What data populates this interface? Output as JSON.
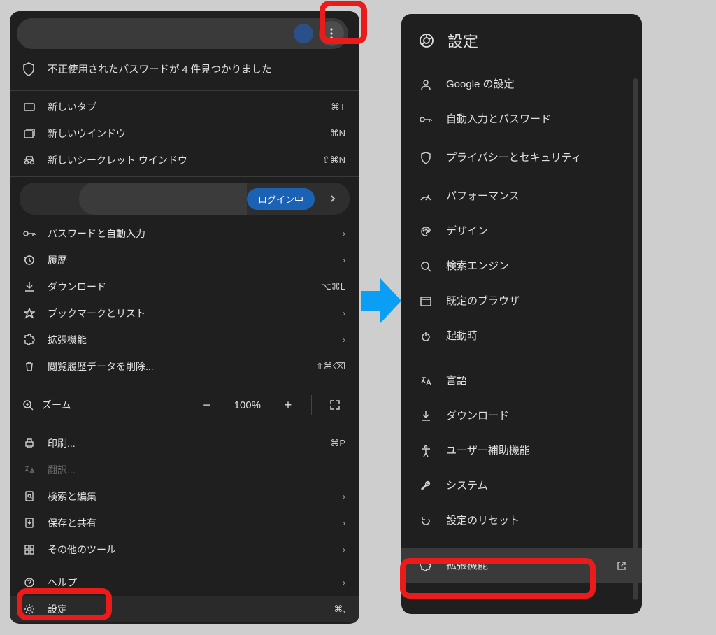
{
  "left": {
    "alert": "不正使用されたパスワードが 4 件見つかりました",
    "new_tab": {
      "label": "新しいタブ",
      "shortcut": "⌘T"
    },
    "new_window": {
      "label": "新しいウインドウ",
      "shortcut": "⌘N"
    },
    "incognito": {
      "label": "新しいシークレット ウインドウ",
      "shortcut": "⇧⌘N"
    },
    "login": "ログイン中",
    "passwords": "パスワードと自動入力",
    "history": "履歴",
    "downloads": {
      "label": "ダウンロード",
      "shortcut": "⌥⌘L"
    },
    "bookmarks": "ブックマークとリスト",
    "extensions": "拡張機能",
    "clear": {
      "label": "閲覧履歴データを削除...",
      "shortcut": "⇧⌘⌫"
    },
    "zoom": {
      "label": "ズーム",
      "value": "100%"
    },
    "print": {
      "label": "印刷...",
      "shortcut": "⌘P"
    },
    "translate": "翻訳...",
    "find": "検索と編集",
    "save": "保存と共有",
    "moretools": "その他のツール",
    "help": "ヘルプ",
    "settings": {
      "label": "設定",
      "shortcut": "⌘,"
    }
  },
  "right": {
    "title": "設定",
    "items": [
      {
        "icon": "person",
        "label": "Google の設定"
      },
      {
        "icon": "key",
        "label": "自動入力とパスワード"
      },
      {
        "icon": "shield",
        "label": "プライバシーとセキュリティ"
      },
      {
        "icon": "speed",
        "label": "パフォーマンス"
      },
      {
        "icon": "palette",
        "label": "デザイン"
      },
      {
        "icon": "search",
        "label": "検索エンジン"
      },
      {
        "icon": "browser",
        "label": "既定のブラウザ"
      },
      {
        "icon": "power",
        "label": "起動時"
      },
      {
        "icon": "lang",
        "label": "言語"
      },
      {
        "icon": "download",
        "label": "ダウンロード"
      },
      {
        "icon": "a11y",
        "label": "ユーザー補助機能"
      },
      {
        "icon": "wrench",
        "label": "システム"
      },
      {
        "icon": "reset",
        "label": "設定のリセット"
      },
      {
        "icon": "ext",
        "label": "拡張機能"
      }
    ]
  }
}
